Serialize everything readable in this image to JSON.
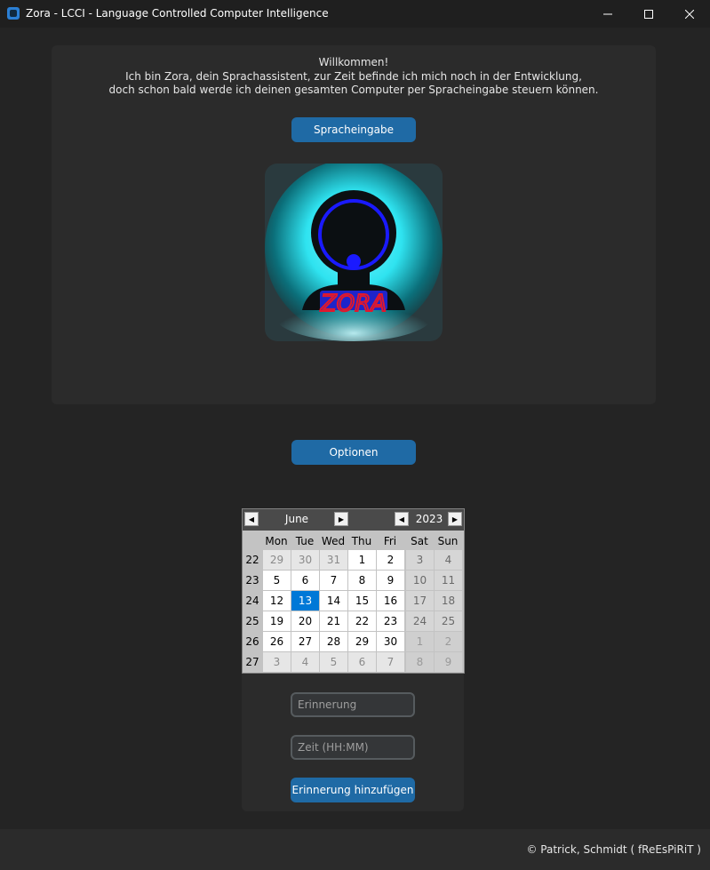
{
  "window": {
    "title": "Zora - LCCI - Language Controlled Computer Intelligence",
    "minimize_icon": "minimize-icon",
    "maximize_icon": "maximize-icon",
    "close_icon": "close-icon"
  },
  "welcome": {
    "line1": "Willkommen!",
    "line2": "Ich bin Zora, dein Sprachassistent, zur Zeit befinde ich mich noch in der Entwicklung,",
    "line3": "doch schon bald werde ich deinen gesamten Computer per Spracheingabe steuern können."
  },
  "buttons": {
    "speech": "Spracheingabe",
    "options": "Optionen",
    "add_reminder": "Erinnerung hinzufügen"
  },
  "logo": {
    "text": "ZORA"
  },
  "calendar": {
    "month": "June",
    "year": "2023",
    "weekdays": [
      "Mon",
      "Tue",
      "Wed",
      "Thu",
      "Fri",
      "Sat",
      "Sun"
    ],
    "weeks": [
      {
        "num": "22",
        "days": [
          {
            "d": "29",
            "o": true
          },
          {
            "d": "30",
            "o": true
          },
          {
            "d": "31",
            "o": true
          },
          {
            "d": "1"
          },
          {
            "d": "2"
          },
          {
            "d": "3"
          },
          {
            "d": "4"
          }
        ]
      },
      {
        "num": "23",
        "days": [
          {
            "d": "5"
          },
          {
            "d": "6"
          },
          {
            "d": "7"
          },
          {
            "d": "8"
          },
          {
            "d": "9"
          },
          {
            "d": "10"
          },
          {
            "d": "11"
          }
        ]
      },
      {
        "num": "24",
        "days": [
          {
            "d": "12"
          },
          {
            "d": "13",
            "sel": true
          },
          {
            "d": "14"
          },
          {
            "d": "15"
          },
          {
            "d": "16"
          },
          {
            "d": "17"
          },
          {
            "d": "18"
          }
        ]
      },
      {
        "num": "25",
        "days": [
          {
            "d": "19"
          },
          {
            "d": "20"
          },
          {
            "d": "21"
          },
          {
            "d": "22"
          },
          {
            "d": "23"
          },
          {
            "d": "24"
          },
          {
            "d": "25"
          }
        ]
      },
      {
        "num": "26",
        "days": [
          {
            "d": "26"
          },
          {
            "d": "27"
          },
          {
            "d": "28"
          },
          {
            "d": "29"
          },
          {
            "d": "30"
          },
          {
            "d": "1",
            "o": true
          },
          {
            "d": "2",
            "o": true
          }
        ]
      },
      {
        "num": "27",
        "days": [
          {
            "d": "3",
            "o": true
          },
          {
            "d": "4",
            "o": true
          },
          {
            "d": "5",
            "o": true
          },
          {
            "d": "6",
            "o": true
          },
          {
            "d": "7",
            "o": true
          },
          {
            "d": "8",
            "o": true
          },
          {
            "d": "9",
            "o": true
          }
        ]
      }
    ],
    "selected_color": "#0078d7"
  },
  "reminder": {
    "text_placeholder": "Erinnerung",
    "time_placeholder": "Zeit (HH:MM)"
  },
  "footer": {
    "copyright": "© Patrick, Schmidt ( fReEsPiRiT )"
  },
  "colors": {
    "accent": "#1f6aa5",
    "background": "#242424",
    "frame": "#2b2b2b"
  }
}
